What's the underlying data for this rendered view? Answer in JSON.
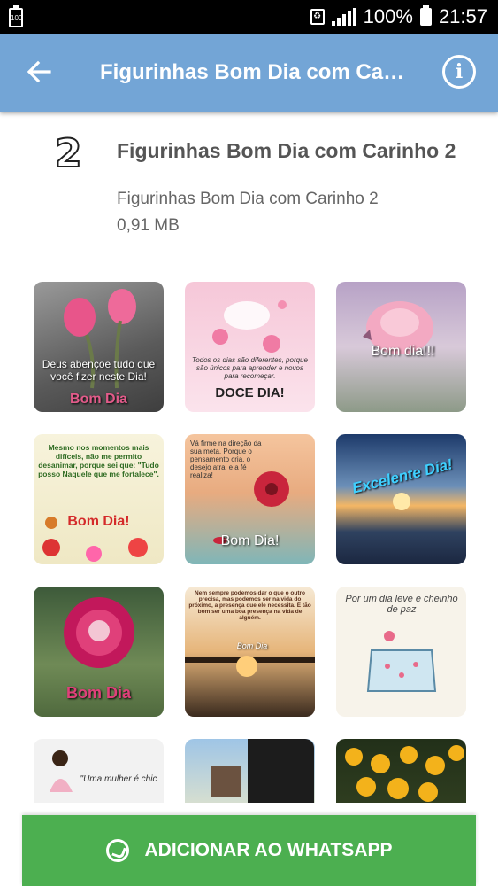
{
  "status_bar": {
    "left_badge": "100",
    "battery_percent": "100%",
    "time": "21:57"
  },
  "app_bar": {
    "title": "Figurinhas Bom Dia com Cari…",
    "back_icon": "arrow-left-icon",
    "info_icon": "info-icon"
  },
  "pack": {
    "icon_text": "2",
    "name": "Figurinhas Bom Dia com Carinho 2",
    "publisher": "Figurinhas Bom Dia com Carinho 2",
    "size": "0,91 MB"
  },
  "stickers": [
    {
      "caption": "Deus abençoe tudo que você fizer neste Dia!",
      "sub": "Bom Dia",
      "theme": "calla-lily"
    },
    {
      "caption": "Todos os dias são diferentes, porque são únicos para aprender e novos para recomeçar.",
      "sub": "DOCE DIA!",
      "theme": "pink-petals"
    },
    {
      "caption": "Bom dia!!!",
      "sub": "",
      "theme": "pink-rose-butterfly"
    },
    {
      "caption": "Mesmo nos momentos mais difíceis, não me permito desanimar, porque sei que: \"Tudo posso Naquele que me fortalece\".",
      "sub": "Bom Dia!",
      "theme": "flowers-bird"
    },
    {
      "caption": "Vá firme na direção da sua meta. Porque o pensamento cria, o desejo atrai e a fé realiza!",
      "sub": "Bom Dia!",
      "theme": "red-flower-water"
    },
    {
      "caption": "Excelente Dia!",
      "sub": "",
      "theme": "sunset-sea"
    },
    {
      "caption": "Bom Dia",
      "sub": "",
      "theme": "magenta-rose"
    },
    {
      "caption": "Nem sempre podemos dar o que o outro precisa, mas podemos ser na vida do próximo, a presença que ele necessita. É tão bom ser uma boa presença na vida de alguém.",
      "sub": "Bom Dia",
      "theme": "swing-sunset"
    },
    {
      "caption": "Por um dia leve e cheinho de paz",
      "sub": "",
      "theme": "watering-can"
    },
    {
      "caption": "\"Uma mulher é chic",
      "sub": "",
      "theme": "woman-bouquet"
    },
    {
      "caption": "",
      "sub": "",
      "theme": "field-stump"
    },
    {
      "caption": "",
      "sub": "",
      "theme": "dark-text"
    },
    {
      "caption": "",
      "sub": "",
      "theme": "sunflowers"
    }
  ],
  "add_button": {
    "label": "ADICIONAR AO WHATSAPP",
    "icon": "whatsapp-icon"
  },
  "colors": {
    "app_bar": "#73a5d6",
    "button": "#4caf50"
  }
}
